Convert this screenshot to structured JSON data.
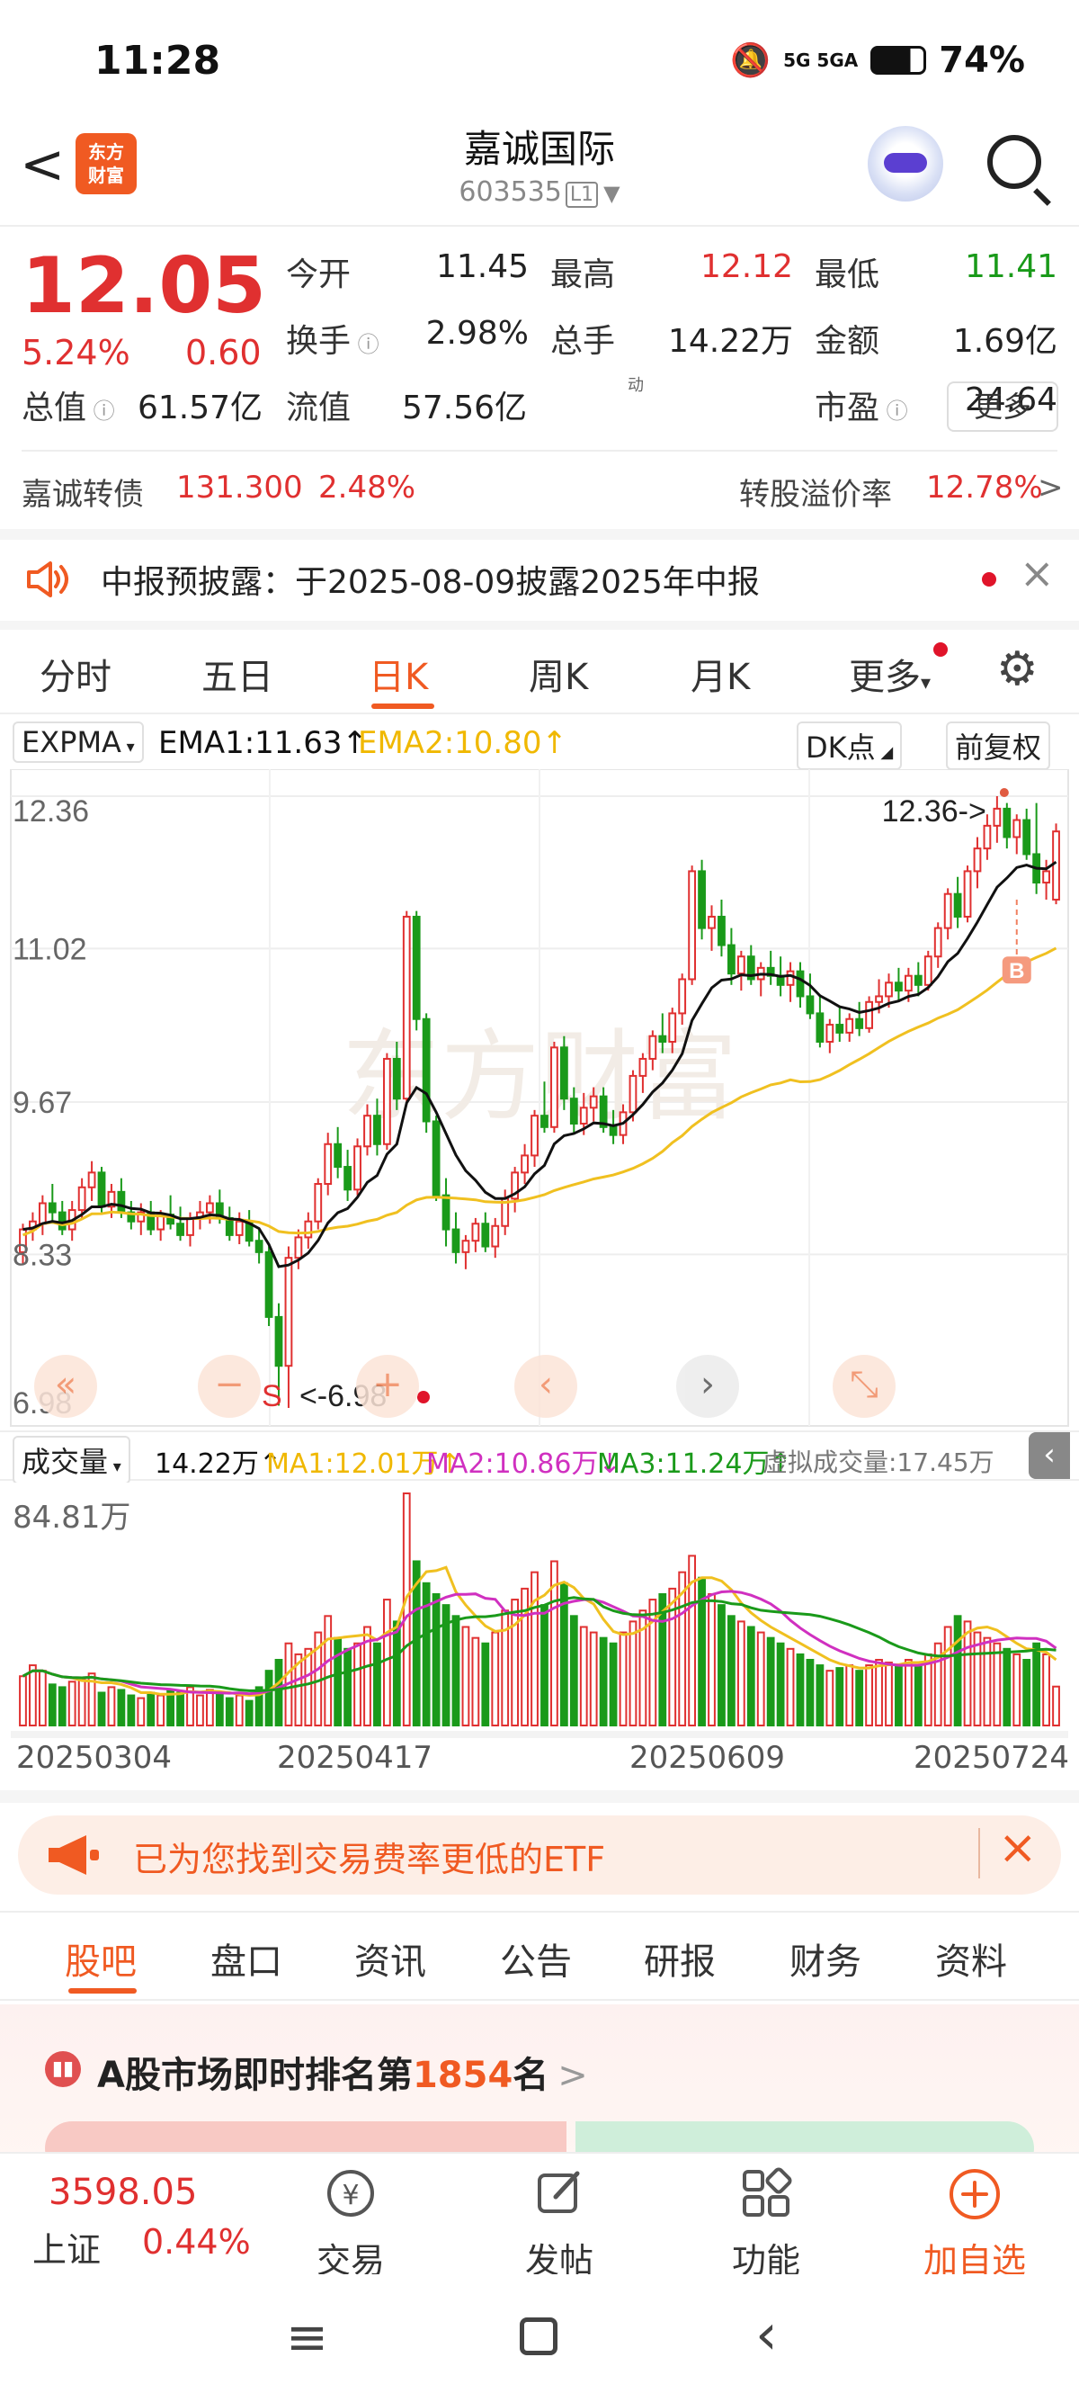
{
  "status_bar": {
    "time": "11:28",
    "network": "5G  5GA",
    "battery": "74%"
  },
  "header": {
    "back": "<",
    "logo_line1": "东方",
    "logo_line2": "财富",
    "stock_name": "嘉诚国际",
    "stock_code": "603535",
    "level_badge": "L1"
  },
  "quote": {
    "price": "12.05",
    "change_pct": "5.24%",
    "change_amt": "0.60",
    "rows": [
      [
        {
          "label": "今开",
          "value": "11.45",
          "color": "normal"
        },
        {
          "label": "最高",
          "value": "12.12",
          "color": "red"
        },
        {
          "label": "最低",
          "value": "11.41",
          "color": "green"
        }
      ],
      [
        {
          "label": "换手",
          "value": "2.98%",
          "color": "normal"
        },
        {
          "label": "总手",
          "value": "14.22万",
          "color": "normal"
        },
        {
          "label": "金额",
          "value": "1.69亿",
          "color": "normal"
        }
      ],
      [
        {
          "label": "总值",
          "value": "61.57亿",
          "color": "normal"
        },
        {
          "label": "流值",
          "value": "57.56亿",
          "color": "normal"
        },
        {
          "label": "市盈",
          "value": "24.64",
          "color": "normal"
        }
      ]
    ],
    "pe_superscript": "动",
    "more_button": "更多"
  },
  "convertible": {
    "name": "嘉诚转债",
    "price": "131.300",
    "pct": "2.48%",
    "premium_label": "转股溢价率",
    "premium_value": "12.78%",
    "arrow": ">"
  },
  "notice": {
    "text": "中报预披露：于2025-08-09披露2025年中报",
    "close": "×"
  },
  "period_tabs": [
    "分时",
    "五日",
    "日K",
    "周K",
    "月K",
    "更多"
  ],
  "active_period": "日K",
  "indicator": {
    "name": "EXPMA",
    "ema1": "EMA1:11.63↑",
    "ema2": "EMA2:10.80↑",
    "dk": "DK点",
    "adjust": "前复权"
  },
  "kline": {
    "y_labels": [
      "12.36",
      "11.02",
      "9.67",
      "8.33",
      "6.98"
    ],
    "high_marker": "12.36->",
    "low_marker": "<-6.98",
    "sell_mark": "S",
    "buy_mark": "B",
    "watermark": "东方财富",
    "controls": [
      "«",
      "−",
      "+",
      "‹",
      "›",
      "⤡"
    ]
  },
  "volume": {
    "name": "成交量",
    "value": "14.22万↑",
    "ma1": "MA1:12.01万↑",
    "ma2": "MA2:10.86万↓",
    "ma3": "MA3:11.24万↑",
    "virtual": "虚拟成交量:17.45万",
    "y_max": "84.81万",
    "dates": [
      "20250304",
      "20250417",
      "20250609",
      "20250724"
    ]
  },
  "chart_data": {
    "type": "candlestick",
    "ylim": [
      6.98,
      12.36
    ],
    "candles": [
      [
        8.35,
        8.6,
        8.25,
        8.55
      ],
      [
        8.55,
        8.7,
        8.45,
        8.62
      ],
      [
        8.6,
        8.85,
        8.5,
        8.78
      ],
      [
        8.78,
        8.95,
        8.6,
        8.7
      ],
      [
        8.7,
        8.8,
        8.5,
        8.55
      ],
      [
        8.55,
        8.8,
        8.45,
        8.72
      ],
      [
        8.72,
        9.0,
        8.65,
        8.92
      ],
      [
        8.92,
        9.15,
        8.8,
        9.05
      ],
      [
        9.05,
        9.1,
        8.7,
        8.75
      ],
      [
        8.75,
        8.95,
        8.65,
        8.88
      ],
      [
        8.88,
        9.0,
        8.65,
        8.7
      ],
      [
        8.7,
        8.8,
        8.55,
        8.62
      ],
      [
        8.62,
        8.78,
        8.5,
        8.7
      ],
      [
        8.7,
        8.8,
        8.5,
        8.55
      ],
      [
        8.55,
        8.72,
        8.45,
        8.68
      ],
      [
        8.68,
        8.85,
        8.55,
        8.6
      ],
      [
        8.6,
        8.75,
        8.45,
        8.5
      ],
      [
        8.5,
        8.7,
        8.4,
        8.65
      ],
      [
        8.65,
        8.8,
        8.55,
        8.7
      ],
      [
        8.7,
        8.85,
        8.6,
        8.78
      ],
      [
        8.78,
        8.9,
        8.6,
        8.65
      ],
      [
        8.65,
        8.75,
        8.45,
        8.5
      ],
      [
        8.5,
        8.7,
        8.42,
        8.62
      ],
      [
        8.62,
        8.72,
        8.4,
        8.45
      ],
      [
        8.45,
        8.55,
        8.25,
        8.35
      ],
      [
        8.35,
        8.4,
        7.7,
        7.78
      ],
      [
        7.78,
        7.9,
        7.0,
        7.35
      ],
      [
        7.35,
        8.4,
        6.98,
        8.3
      ],
      [
        8.3,
        8.55,
        8.2,
        8.48
      ],
      [
        8.48,
        8.7,
        8.38,
        8.62
      ],
      [
        8.62,
        9.0,
        8.55,
        8.95
      ],
      [
        8.95,
        9.4,
        8.85,
        9.3
      ],
      [
        9.3,
        9.45,
        9.0,
        9.1
      ],
      [
        9.1,
        9.25,
        8.8,
        8.9
      ],
      [
        8.9,
        9.35,
        8.85,
        9.28
      ],
      [
        9.28,
        9.65,
        9.2,
        9.55
      ],
      [
        9.55,
        9.7,
        9.2,
        9.3
      ],
      [
        9.3,
        10.1,
        9.25,
        10.05
      ],
      [
        10.05,
        10.2,
        9.6,
        9.7
      ],
      [
        9.7,
        11.35,
        9.65,
        11.3
      ],
      [
        11.3,
        11.35,
        10.3,
        10.4
      ],
      [
        10.4,
        10.45,
        9.4,
        9.5
      ],
      [
        9.5,
        9.55,
        8.8,
        8.85
      ],
      [
        8.85,
        9.0,
        8.4,
        8.55
      ],
      [
        8.55,
        8.7,
        8.25,
        8.35
      ],
      [
        8.35,
        8.5,
        8.2,
        8.45
      ],
      [
        8.45,
        8.65,
        8.35,
        8.6
      ],
      [
        8.6,
        8.7,
        8.35,
        8.4
      ],
      [
        8.4,
        8.65,
        8.3,
        8.58
      ],
      [
        8.58,
        8.9,
        8.5,
        8.82
      ],
      [
        8.82,
        9.1,
        8.7,
        9.05
      ],
      [
        9.05,
        9.3,
        8.95,
        9.2
      ],
      [
        9.2,
        9.6,
        9.1,
        9.55
      ],
      [
        9.55,
        9.85,
        9.4,
        9.45
      ],
      [
        9.45,
        10.2,
        9.4,
        10.15
      ],
      [
        10.15,
        10.25,
        9.6,
        9.7
      ],
      [
        9.7,
        9.8,
        9.4,
        9.48
      ],
      [
        9.48,
        9.75,
        9.38,
        9.62
      ],
      [
        9.62,
        9.8,
        9.5,
        9.72
      ],
      [
        9.72,
        9.8,
        9.4,
        9.45
      ],
      [
        9.45,
        9.6,
        9.3,
        9.38
      ],
      [
        9.38,
        9.65,
        9.3,
        9.58
      ],
      [
        9.58,
        9.95,
        9.5,
        9.9
      ],
      [
        9.9,
        10.1,
        9.75,
        10.05
      ],
      [
        10.05,
        10.3,
        9.95,
        10.25
      ],
      [
        10.25,
        10.45,
        10.1,
        10.2
      ],
      [
        10.2,
        10.5,
        10.1,
        10.45
      ],
      [
        10.45,
        10.8,
        10.35,
        10.75
      ],
      [
        10.75,
        11.75,
        10.7,
        11.7
      ],
      [
        11.7,
        11.8,
        11.1,
        11.2
      ],
      [
        11.2,
        11.4,
        11.0,
        11.3
      ],
      [
        11.3,
        11.45,
        10.95,
        11.05
      ],
      [
        11.05,
        11.2,
        10.7,
        10.8
      ],
      [
        10.8,
        11.0,
        10.65,
        10.95
      ],
      [
        10.95,
        11.05,
        10.7,
        10.75
      ],
      [
        10.75,
        10.9,
        10.6,
        10.85
      ],
      [
        10.85,
        11.0,
        10.7,
        10.78
      ],
      [
        10.78,
        10.95,
        10.6,
        10.7
      ],
      [
        10.7,
        10.9,
        10.55,
        10.82
      ],
      [
        10.82,
        10.9,
        10.5,
        10.6
      ],
      [
        10.6,
        10.8,
        10.4,
        10.45
      ],
      [
        10.45,
        10.6,
        10.15,
        10.2
      ],
      [
        10.2,
        10.4,
        10.1,
        10.35
      ],
      [
        10.35,
        10.5,
        10.2,
        10.28
      ],
      [
        10.28,
        10.45,
        10.2,
        10.4
      ],
      [
        10.4,
        10.55,
        10.25,
        10.32
      ],
      [
        10.32,
        10.6,
        10.28,
        10.55
      ],
      [
        10.55,
        10.75,
        10.45,
        10.6
      ],
      [
        10.6,
        10.8,
        10.5,
        10.72
      ],
      [
        10.72,
        10.85,
        10.55,
        10.65
      ],
      [
        10.65,
        10.85,
        10.55,
        10.78
      ],
      [
        10.78,
        10.9,
        10.6,
        10.7
      ],
      [
        10.7,
        11.0,
        10.65,
        10.95
      ],
      [
        10.95,
        11.25,
        10.85,
        11.2
      ],
      [
        11.2,
        11.55,
        11.1,
        11.5
      ],
      [
        11.5,
        11.65,
        11.2,
        11.3
      ],
      [
        11.3,
        11.75,
        11.25,
        11.7
      ],
      [
        11.7,
        12.0,
        11.55,
        11.9
      ],
      [
        11.9,
        12.2,
        11.8,
        12.1
      ],
      [
        12.1,
        12.36,
        11.95,
        12.25
      ],
      [
        12.25,
        12.3,
        11.9,
        12.0
      ],
      [
        12.0,
        12.2,
        11.85,
        12.15
      ],
      [
        12.15,
        12.25,
        11.8,
        11.85
      ],
      [
        11.85,
        12.3,
        11.5,
        11.6
      ],
      [
        11.6,
        11.8,
        11.45,
        11.7
      ],
      [
        11.45,
        12.12,
        11.41,
        12.05
      ]
    ],
    "volumes": [
      18,
      22,
      20,
      15,
      14,
      16,
      17,
      19,
      12,
      14,
      13,
      11,
      10,
      12,
      11,
      13,
      12,
      14,
      11,
      13,
      12,
      10,
      11,
      9,
      14,
      20,
      24,
      30,
      26,
      28,
      34,
      40,
      32,
      28,
      30,
      36,
      30,
      46,
      38,
      84.81,
      60,
      52,
      48,
      44,
      40,
      36,
      32,
      30,
      34,
      42,
      46,
      50,
      56,
      44,
      60,
      52,
      40,
      36,
      34,
      32,
      30,
      34,
      38,
      42,
      46,
      48,
      50,
      56,
      62,
      54,
      48,
      44,
      40,
      38,
      36,
      34,
      32,
      30,
      28,
      26,
      24,
      22,
      20,
      21,
      22,
      20,
      22,
      24,
      23,
      22,
      24,
      22,
      26,
      30,
      36,
      40,
      38,
      34,
      32,
      30,
      28,
      26,
      24,
      30,
      26,
      14.22
    ],
    "ema1_last": 11.63,
    "ema2_last": 10.8,
    "x_ticks": [
      "20250304",
      "20250417",
      "20250609",
      "20250724"
    ]
  },
  "etf_banner": {
    "text": "已为您找到交易费率更低的ETF",
    "close": "×"
  },
  "sub_tabs": [
    "股吧",
    "盘口",
    "资讯",
    "公告",
    "研报",
    "财务",
    "资料"
  ],
  "active_sub_tab": "股吧",
  "rank": {
    "prefix": "A股市场即时排名第",
    "rank": "1854",
    "suffix": "名",
    "arrow": ">"
  },
  "bottom_bar": {
    "index_value": "3598.05",
    "index_name": "上证",
    "index_pct": "0.44%",
    "items": [
      {
        "label": "交易",
        "icon": "yen-icon"
      },
      {
        "label": "发帖",
        "icon": "edit-icon"
      },
      {
        "label": "功能",
        "icon": "grid-icon"
      },
      {
        "label": "加自选",
        "icon": "plus-circle-icon"
      }
    ]
  },
  "colors": {
    "up": "#e03030",
    "down": "#1a9a1a",
    "accent": "#f05a22",
    "ema1": "#111111",
    "ema2": "#f0c020",
    "ma2": "#d030c0"
  }
}
